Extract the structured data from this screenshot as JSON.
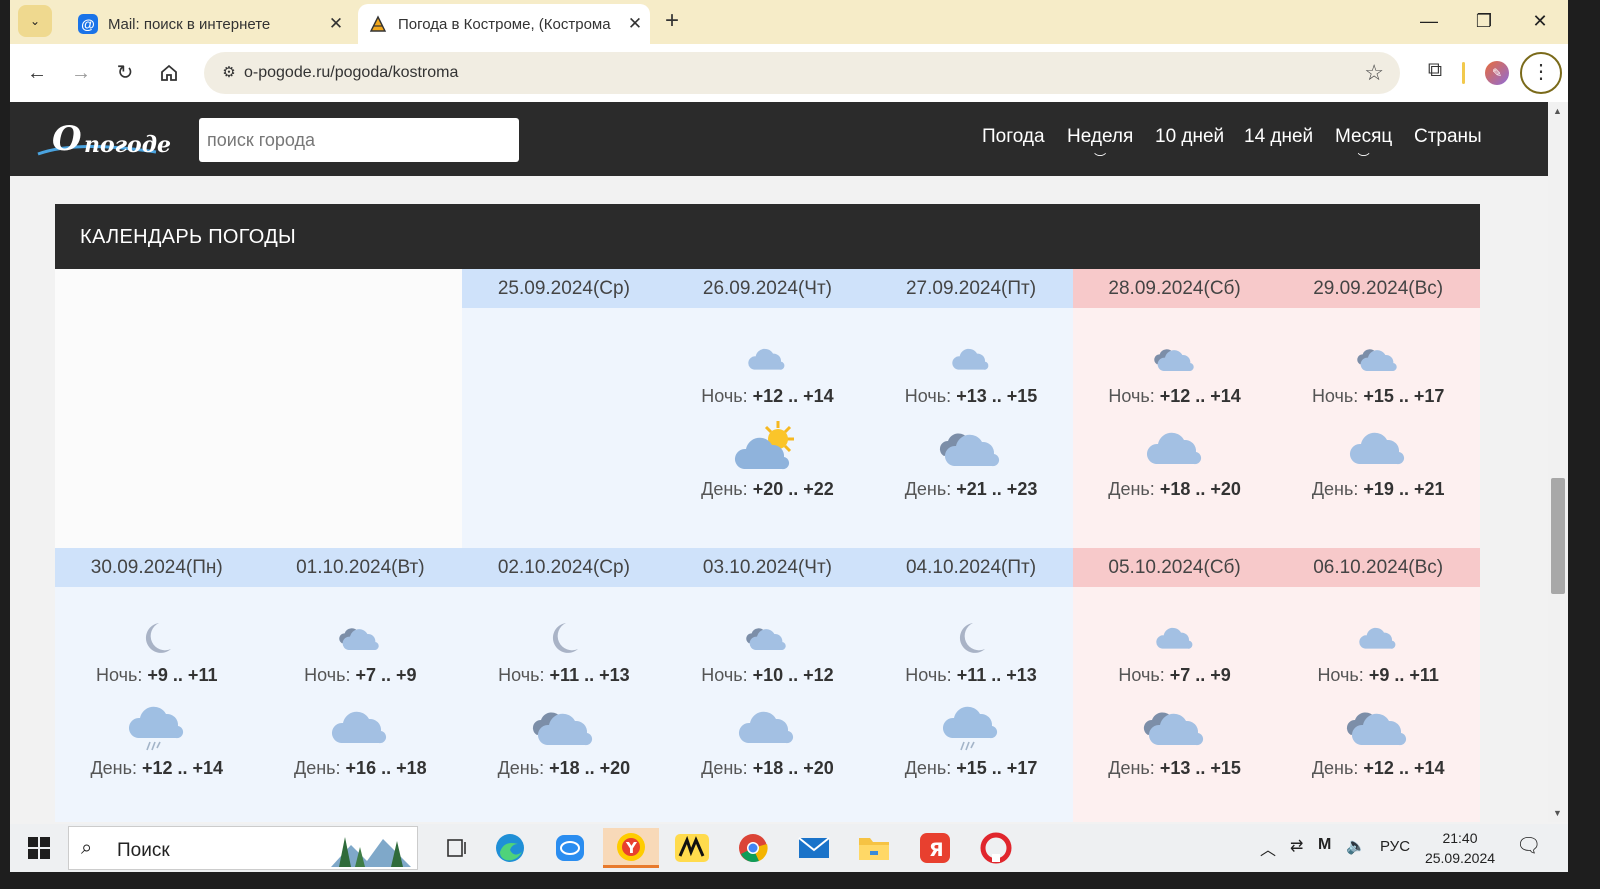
{
  "browser": {
    "tabs": [
      {
        "title": "Mail: поиск в интернете",
        "active": false
      },
      {
        "title": "Погода в Костроме, (Кострома",
        "active": true
      }
    ],
    "new_tab": "+",
    "url": "o-pogode.ru/pogoda/kostroma"
  },
  "site": {
    "search_placeholder": "поиск города",
    "menu": [
      "Погода",
      "Неделя",
      "10 дней",
      "14 дней",
      "Месяц",
      "Страны"
    ]
  },
  "calendar": {
    "title": "КАЛЕНДАРЬ ПОГОДЫ",
    "weeks": [
      [
        null,
        null,
        {
          "date": "25.09.2024(Ср)",
          "weekend": false
        },
        {
          "date": "26.09.2024(Чт)",
          "weekend": false,
          "night_icon": "cloud-icon",
          "night_label": "Ночь:",
          "night": "+12 .. +14",
          "day_icon": "partly-sunny-icon",
          "day_label": "День:",
          "day": "+20 .. +22"
        },
        {
          "date": "27.09.2024(Пт)",
          "weekend": false,
          "night_icon": "cloud-icon",
          "night_label": "Ночь:",
          "night": "+13 .. +15",
          "day_icon": "overcast-icon",
          "day_label": "День:",
          "day": "+21 .. +23"
        },
        {
          "date": "28.09.2024(Сб)",
          "weekend": true,
          "night_icon": "overcast-icon",
          "night_label": "Ночь:",
          "night": "+12 .. +14",
          "day_icon": "cloud-icon",
          "day_label": "День:",
          "day": "+18 .. +20"
        },
        {
          "date": "29.09.2024(Вс)",
          "weekend": true,
          "night_icon": "overcast-icon",
          "night_label": "Ночь:",
          "night": "+15 .. +17",
          "day_icon": "cloud-icon",
          "day_label": "День:",
          "day": "+19 .. +21"
        }
      ],
      [
        {
          "date": "30.09.2024(Пн)",
          "weekend": false,
          "night_icon": "moon-icon",
          "night_label": "Ночь:",
          "night": "+9 .. +11",
          "day_icon": "rain-cloud-icon",
          "day_label": "День:",
          "day": "+12 .. +14"
        },
        {
          "date": "01.10.2024(Вт)",
          "weekend": false,
          "night_icon": "overcast-icon",
          "night_label": "Ночь:",
          "night": "+7 .. +9",
          "day_icon": "cloud-icon",
          "day_label": "День:",
          "day": "+16 .. +18"
        },
        {
          "date": "02.10.2024(Ср)",
          "weekend": false,
          "night_icon": "moon-icon",
          "night_label": "Ночь:",
          "night": "+11 .. +13",
          "day_icon": "overcast-icon",
          "day_label": "День:",
          "day": "+18 .. +20"
        },
        {
          "date": "03.10.2024(Чт)",
          "weekend": false,
          "night_icon": "overcast-icon",
          "night_label": "Ночь:",
          "night": "+10 .. +12",
          "day_icon": "cloud-icon",
          "day_label": "День:",
          "day": "+18 .. +20"
        },
        {
          "date": "04.10.2024(Пт)",
          "weekend": false,
          "night_icon": "moon-icon",
          "night_label": "Ночь:",
          "night": "+11 .. +13",
          "day_icon": "rain-cloud-icon",
          "day_label": "День:",
          "day": "+15 .. +17"
        },
        {
          "date": "05.10.2024(Сб)",
          "weekend": true,
          "night_icon": "cloud-icon",
          "night_label": "Ночь:",
          "night": "+7 .. +9",
          "day_icon": "overcast-icon",
          "day_label": "День:",
          "day": "+13 .. +15"
        },
        {
          "date": "06.10.2024(Вс)",
          "weekend": true,
          "night_icon": "cloud-icon",
          "night_label": "Ночь:",
          "night": "+9 .. +11",
          "day_icon": "overcast-icon",
          "day_label": "День:",
          "day": "+12 .. +14"
        }
      ]
    ]
  },
  "taskbar": {
    "search_label": "Поиск",
    "language": "РУС",
    "time": "21:40",
    "date": "25.09.2024"
  },
  "colors": {
    "header_bg": "#2b2b2b",
    "weekday_header": "#cfe2fa",
    "weekend_header": "#f7c9ca",
    "icon_blue": "#8fb3dc"
  }
}
